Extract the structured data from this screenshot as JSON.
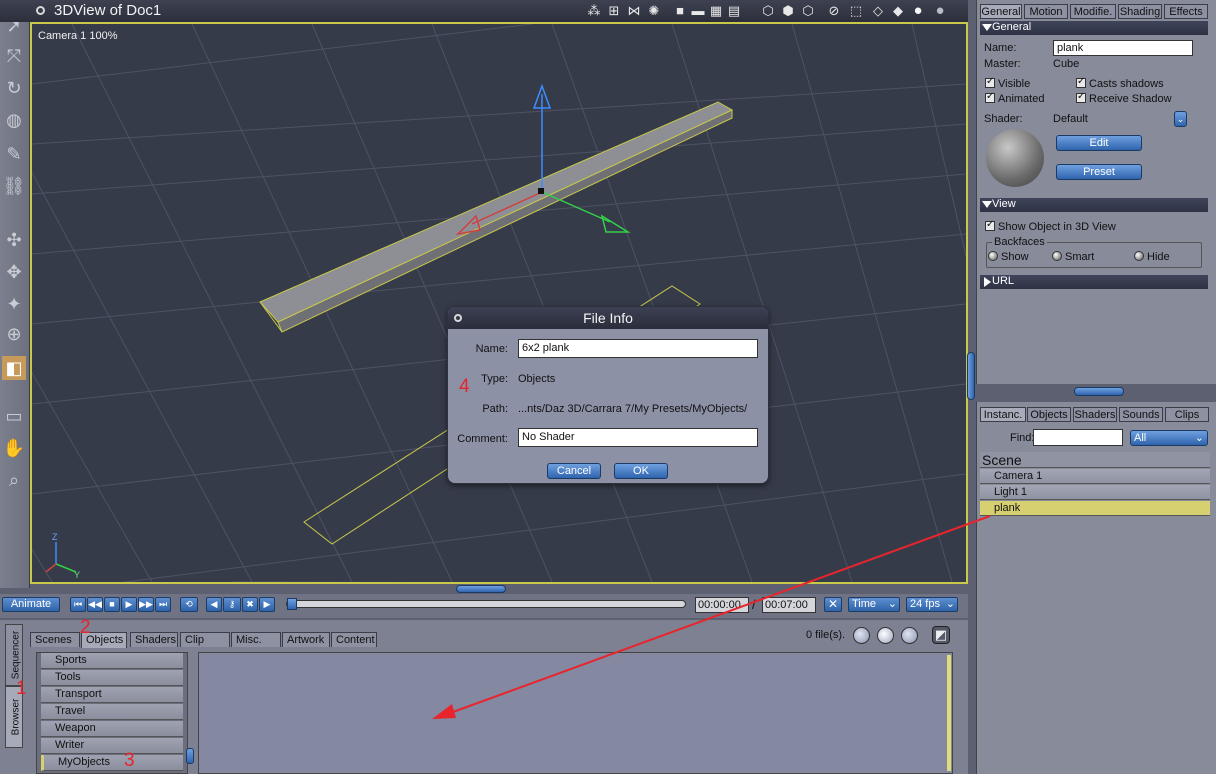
{
  "window": {
    "title": "3DView of Doc1"
  },
  "viewport": {
    "camera_label": "Camera 1 100%"
  },
  "toolbar_icons": [
    "move-icon",
    "camera-icon",
    "render-area-icon",
    "zoom-icon",
    "preview-box-icon",
    "preview-full-icon",
    "shading-icon",
    "shading-icon",
    "shading-icon",
    "shading-icon",
    "sphere-icon",
    "sphere-icon"
  ],
  "animation_bar": {
    "animate_label": "Animate",
    "current_time": "00:00:00",
    "separator": "/",
    "end_time": "00:07:00",
    "time_mode": "Time",
    "fps": "24 fps"
  },
  "browser": {
    "side_tabs": [
      "Sequencer",
      "Browser"
    ],
    "tabs": [
      "Scenes",
      "Objects",
      "Shaders",
      "Clip",
      "Misc.",
      "Artwork",
      "Content"
    ],
    "active_tab": "Objects",
    "file_count": "0 file(s).",
    "categories": [
      "Sports",
      "Tools",
      "Transport",
      "Travel",
      "Weapon",
      "Writer",
      "MyObjects"
    ]
  },
  "properties": {
    "tabs": [
      "General",
      "Motion",
      "Modifie.",
      "Shading",
      "Effects"
    ],
    "general_section": "General",
    "name_label": "Name:",
    "name_value": "plank",
    "master_label": "Master:",
    "master_value": "Cube",
    "visible": "Visible",
    "casts_shadows": "Casts shadows",
    "animated": "Animated",
    "receive_shadow": "Receive Shadow",
    "shader_label": "Shader:",
    "shader_value": "Default",
    "edit_btn": "Edit",
    "preset_btn": "Preset",
    "view_section": "View",
    "show_in_3d": "Show Object in 3D View",
    "backfaces_label": "Backfaces",
    "backface_show": "Show",
    "backface_smart": "Smart",
    "backface_hide": "Hide",
    "url_section": "URL"
  },
  "instances": {
    "tabs": [
      "Instanc.",
      "Objects",
      "Shaders",
      "Sounds",
      "Clips"
    ],
    "find_label": "Find:",
    "find_value": "",
    "filter": "All",
    "scene_label": "Scene",
    "rows": [
      "Camera 1",
      "Light 1",
      "plank"
    ],
    "selected": "plank"
  },
  "dialog": {
    "title": "File Info",
    "name_label": "Name:",
    "name_value": "6x2 plank",
    "type_label": "Type:",
    "type_value": "Objects",
    "path_label": "Path:",
    "path_value": "...nts/Daz 3D/Carrara 7/My Presets/MyObjects/",
    "comment_label": "Comment:",
    "comment_value": "No Shader",
    "cancel_label": "Cancel",
    "ok_label": "OK"
  },
  "annotations": [
    "1",
    "2",
    "3",
    "4"
  ],
  "colors": {
    "accent_blue": "#2f64ad",
    "selection_yellow": "#d6d070",
    "annotation_red": "#e8242c",
    "viewport_bg": "#363b49"
  }
}
